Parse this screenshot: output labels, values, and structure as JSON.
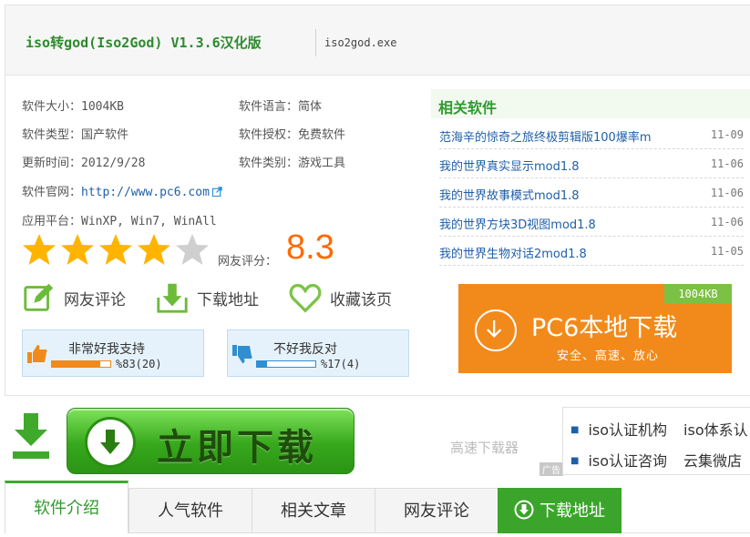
{
  "header": {
    "title": "iso转god(Iso2God) V1.3.6汉化版",
    "filename": "iso2god.exe"
  },
  "info": {
    "size_label": "软件大小：",
    "size": "1004KB",
    "language_label": "软件语言：",
    "language": "简体",
    "type_label": "软件类型：",
    "type": "国产软件",
    "license_label": "软件授权：",
    "license": "免费软件",
    "updated_label": "更新时间：",
    "updated": "2012/9/28",
    "category_label": "软件类别：",
    "category": "游戏工具",
    "website_label": "软件官网：",
    "website": "http://www.pc6.com",
    "platform_label": "应用平台：",
    "platform": "WinXP, Win7, WinAll"
  },
  "rating": {
    "stars_filled": 4,
    "stars_total": 5,
    "score_label": "网友评分：",
    "score": "8.3"
  },
  "actions": {
    "comment": "网友评论",
    "download_address": "下载地址",
    "favorite": "收藏该页"
  },
  "votes": {
    "support_label": "非常好我支持",
    "support_pct": "%83(20)",
    "support_fraction": 0.83,
    "oppose_label": "不好我反对",
    "oppose_pct": "%17(4)",
    "oppose_fraction": 0.17
  },
  "related": {
    "heading": "相关软件",
    "items": [
      {
        "title": "范海辛的惊奇之旅终极剪辑版100爆率m",
        "date": "11-09"
      },
      {
        "title": "我的世界真实显示mod1.8",
        "date": "11-06"
      },
      {
        "title": "我的世界故事模式mod1.8",
        "date": "11-06"
      },
      {
        "title": "我的世界方块3D视图mod1.8",
        "date": "11-06"
      },
      {
        "title": "我的世界生物对话2mod1.8",
        "date": "11-05"
      }
    ]
  },
  "local_download": {
    "size_tag": "1004KB",
    "main": "PC6本地下载",
    "sub": "安全、高速、放心"
  },
  "download_button": {
    "label": "立即下载",
    "fast_downloader": "高速下载器",
    "ad_tag": "广告"
  },
  "ads": {
    "row1": [
      "iso认证机构",
      "iso体系认"
    ],
    "row2": [
      "iso认证咨询",
      "云集微店"
    ]
  },
  "tabs": [
    {
      "label": "软件介绍"
    },
    {
      "label": "人气软件"
    },
    {
      "label": "相关文章"
    },
    {
      "label": "网友评论"
    },
    {
      "label": "下载地址"
    }
  ],
  "colors": {
    "accent_green": "#3aa52a",
    "orange": "#f28a1b",
    "score_orange": "#ff6a00",
    "link_blue": "#1f5fa8"
  }
}
